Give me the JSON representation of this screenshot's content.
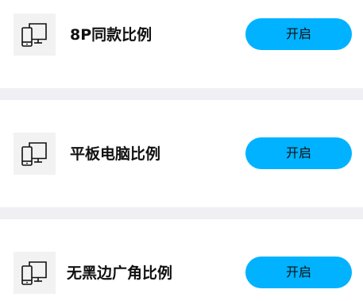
{
  "options": [
    {
      "icon": "phone-monitor-icon",
      "label": "8P同款比例",
      "button_label": "开启"
    },
    {
      "icon": "phone-monitor-icon",
      "label": "平板电脑比例",
      "button_label": "开启"
    },
    {
      "icon": "phone-monitor-icon",
      "label": "无黑边广角比例",
      "button_label": "开启"
    }
  ],
  "colors": {
    "button": "#00b2ff",
    "separator": "#efeff4",
    "icon_bg": "#f2f2f2"
  }
}
